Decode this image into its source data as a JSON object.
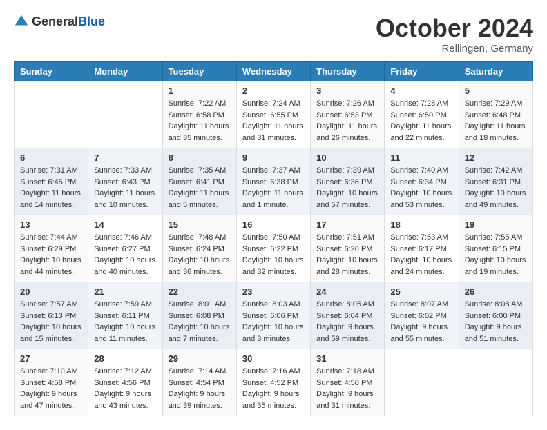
{
  "header": {
    "logo": {
      "general": "General",
      "blue": "Blue",
      "icon": "▶"
    },
    "title": "October 2024",
    "location": "Rellingen, Germany"
  },
  "weekdays": [
    "Sunday",
    "Monday",
    "Tuesday",
    "Wednesday",
    "Thursday",
    "Friday",
    "Saturday"
  ],
  "weeks": [
    [
      {
        "day": "",
        "sunrise": "",
        "sunset": "",
        "daylight": ""
      },
      {
        "day": "",
        "sunrise": "",
        "sunset": "",
        "daylight": ""
      },
      {
        "day": "1",
        "sunrise": "Sunrise: 7:22 AM",
        "sunset": "Sunset: 6:58 PM",
        "daylight": "Daylight: 11 hours and 35 minutes."
      },
      {
        "day": "2",
        "sunrise": "Sunrise: 7:24 AM",
        "sunset": "Sunset: 6:55 PM",
        "daylight": "Daylight: 11 hours and 31 minutes."
      },
      {
        "day": "3",
        "sunrise": "Sunrise: 7:26 AM",
        "sunset": "Sunset: 6:53 PM",
        "daylight": "Daylight: 11 hours and 26 minutes."
      },
      {
        "day": "4",
        "sunrise": "Sunrise: 7:28 AM",
        "sunset": "Sunset: 6:50 PM",
        "daylight": "Daylight: 11 hours and 22 minutes."
      },
      {
        "day": "5",
        "sunrise": "Sunrise: 7:29 AM",
        "sunset": "Sunset: 6:48 PM",
        "daylight": "Daylight: 11 hours and 18 minutes."
      }
    ],
    [
      {
        "day": "6",
        "sunrise": "Sunrise: 7:31 AM",
        "sunset": "Sunset: 6:45 PM",
        "daylight": "Daylight: 11 hours and 14 minutes."
      },
      {
        "day": "7",
        "sunrise": "Sunrise: 7:33 AM",
        "sunset": "Sunset: 6:43 PM",
        "daylight": "Daylight: 11 hours and 10 minutes."
      },
      {
        "day": "8",
        "sunrise": "Sunrise: 7:35 AM",
        "sunset": "Sunset: 6:41 PM",
        "daylight": "Daylight: 11 hours and 5 minutes."
      },
      {
        "day": "9",
        "sunrise": "Sunrise: 7:37 AM",
        "sunset": "Sunset: 6:38 PM",
        "daylight": "Daylight: 11 hours and 1 minute."
      },
      {
        "day": "10",
        "sunrise": "Sunrise: 7:39 AM",
        "sunset": "Sunset: 6:36 PM",
        "daylight": "Daylight: 10 hours and 57 minutes."
      },
      {
        "day": "11",
        "sunrise": "Sunrise: 7:40 AM",
        "sunset": "Sunset: 6:34 PM",
        "daylight": "Daylight: 10 hours and 53 minutes."
      },
      {
        "day": "12",
        "sunrise": "Sunrise: 7:42 AM",
        "sunset": "Sunset: 6:31 PM",
        "daylight": "Daylight: 10 hours and 49 minutes."
      }
    ],
    [
      {
        "day": "13",
        "sunrise": "Sunrise: 7:44 AM",
        "sunset": "Sunset: 6:29 PM",
        "daylight": "Daylight: 10 hours and 44 minutes."
      },
      {
        "day": "14",
        "sunrise": "Sunrise: 7:46 AM",
        "sunset": "Sunset: 6:27 PM",
        "daylight": "Daylight: 10 hours and 40 minutes."
      },
      {
        "day": "15",
        "sunrise": "Sunrise: 7:48 AM",
        "sunset": "Sunset: 6:24 PM",
        "daylight": "Daylight: 10 hours and 36 minutes."
      },
      {
        "day": "16",
        "sunrise": "Sunrise: 7:50 AM",
        "sunset": "Sunset: 6:22 PM",
        "daylight": "Daylight: 10 hours and 32 minutes."
      },
      {
        "day": "17",
        "sunrise": "Sunrise: 7:51 AM",
        "sunset": "Sunset: 6:20 PM",
        "daylight": "Daylight: 10 hours and 28 minutes."
      },
      {
        "day": "18",
        "sunrise": "Sunrise: 7:53 AM",
        "sunset": "Sunset: 6:17 PM",
        "daylight": "Daylight: 10 hours and 24 minutes."
      },
      {
        "day": "19",
        "sunrise": "Sunrise: 7:55 AM",
        "sunset": "Sunset: 6:15 PM",
        "daylight": "Daylight: 10 hours and 19 minutes."
      }
    ],
    [
      {
        "day": "20",
        "sunrise": "Sunrise: 7:57 AM",
        "sunset": "Sunset: 6:13 PM",
        "daylight": "Daylight: 10 hours and 15 minutes."
      },
      {
        "day": "21",
        "sunrise": "Sunrise: 7:59 AM",
        "sunset": "Sunset: 6:11 PM",
        "daylight": "Daylight: 10 hours and 11 minutes."
      },
      {
        "day": "22",
        "sunrise": "Sunrise: 8:01 AM",
        "sunset": "Sunset: 6:08 PM",
        "daylight": "Daylight: 10 hours and 7 minutes."
      },
      {
        "day": "23",
        "sunrise": "Sunrise: 8:03 AM",
        "sunset": "Sunset: 6:06 PM",
        "daylight": "Daylight: 10 hours and 3 minutes."
      },
      {
        "day": "24",
        "sunrise": "Sunrise: 8:05 AM",
        "sunset": "Sunset: 6:04 PM",
        "daylight": "Daylight: 9 hours and 59 minutes."
      },
      {
        "day": "25",
        "sunrise": "Sunrise: 8:07 AM",
        "sunset": "Sunset: 6:02 PM",
        "daylight": "Daylight: 9 hours and 55 minutes."
      },
      {
        "day": "26",
        "sunrise": "Sunrise: 8:08 AM",
        "sunset": "Sunset: 6:00 PM",
        "daylight": "Daylight: 9 hours and 51 minutes."
      }
    ],
    [
      {
        "day": "27",
        "sunrise": "Sunrise: 7:10 AM",
        "sunset": "Sunset: 4:58 PM",
        "daylight": "Daylight: 9 hours and 47 minutes."
      },
      {
        "day": "28",
        "sunrise": "Sunrise: 7:12 AM",
        "sunset": "Sunset: 4:56 PM",
        "daylight": "Daylight: 9 hours and 43 minutes."
      },
      {
        "day": "29",
        "sunrise": "Sunrise: 7:14 AM",
        "sunset": "Sunset: 4:54 PM",
        "daylight": "Daylight: 9 hours and 39 minutes."
      },
      {
        "day": "30",
        "sunrise": "Sunrise: 7:16 AM",
        "sunset": "Sunset: 4:52 PM",
        "daylight": "Daylight: 9 hours and 35 minutes."
      },
      {
        "day": "31",
        "sunrise": "Sunrise: 7:18 AM",
        "sunset": "Sunset: 4:50 PM",
        "daylight": "Daylight: 9 hours and 31 minutes."
      },
      {
        "day": "",
        "sunrise": "",
        "sunset": "",
        "daylight": ""
      },
      {
        "day": "",
        "sunrise": "",
        "sunset": "",
        "daylight": ""
      }
    ]
  ]
}
